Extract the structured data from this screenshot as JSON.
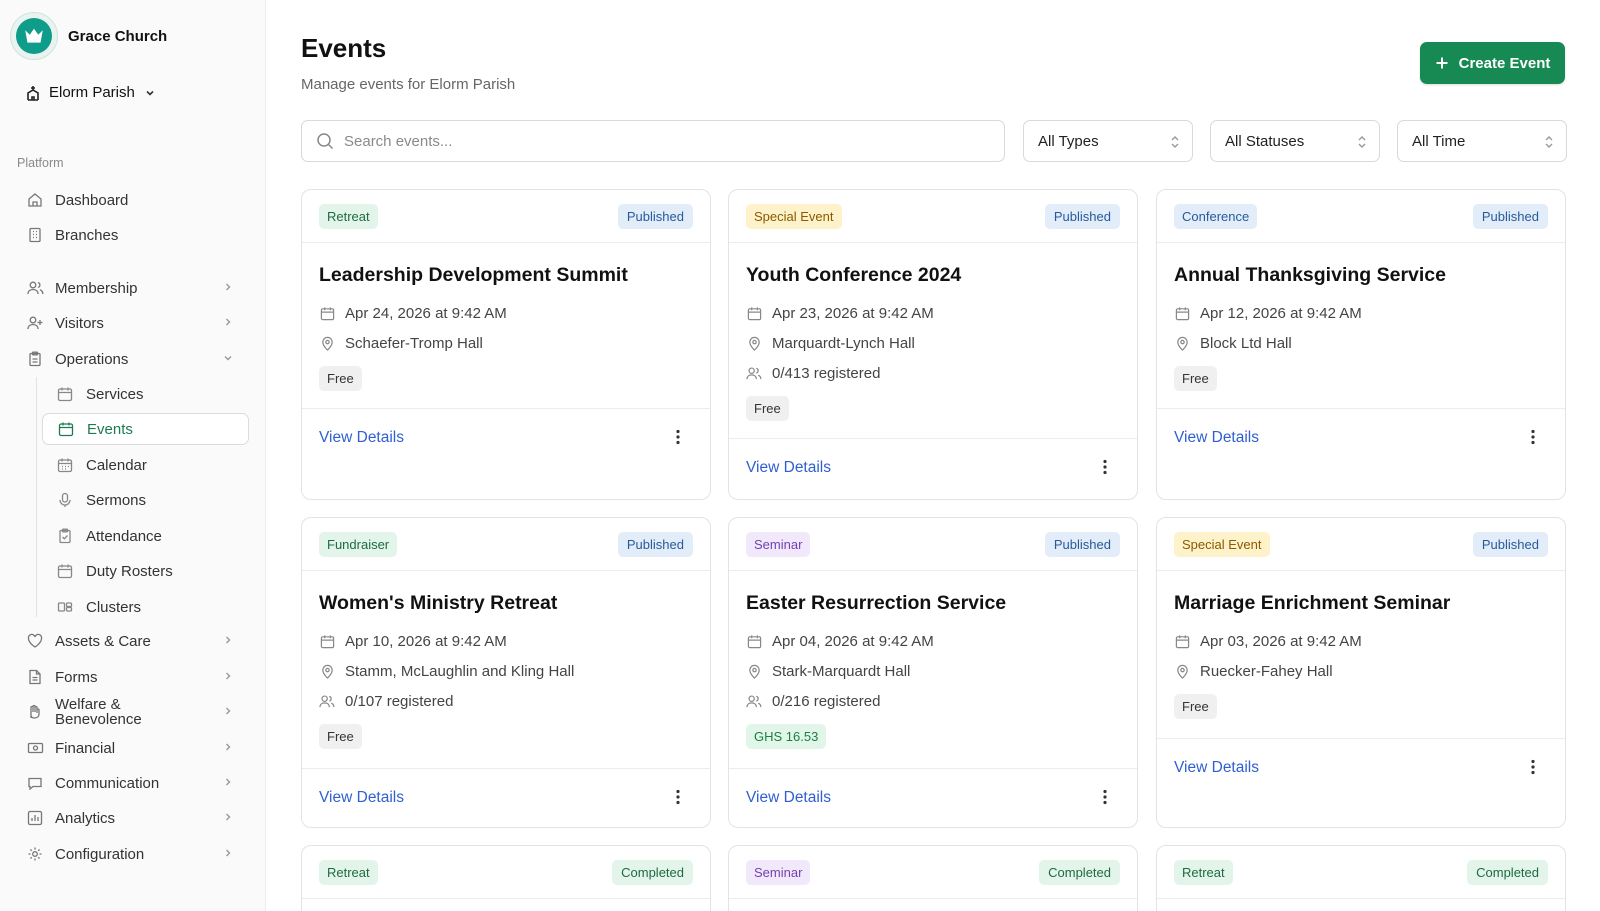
{
  "brand": {
    "name": "Grace Church"
  },
  "parish": {
    "name": "Elorm Parish"
  },
  "sidebar": {
    "section_label": "Platform",
    "items": [
      {
        "label": "Dashboard",
        "icon": "home-icon",
        "expandable": false
      },
      {
        "label": "Branches",
        "icon": "building-icon",
        "expandable": false
      },
      {
        "label": "Membership",
        "icon": "users-icon",
        "expandable": true
      },
      {
        "label": "Visitors",
        "icon": "user-plus-icon",
        "expandable": true
      },
      {
        "label": "Operations",
        "icon": "clipboard-icon",
        "expandable": true,
        "expanded": true
      },
      {
        "label": "Assets & Care",
        "icon": "heart-icon",
        "expandable": true
      },
      {
        "label": "Forms",
        "icon": "file-icon",
        "expandable": true
      },
      {
        "label": "Welfare & Benevolence",
        "icon": "hand-icon",
        "expandable": true
      },
      {
        "label": "Financial",
        "icon": "banknote-icon",
        "expandable": true
      },
      {
        "label": "Communication",
        "icon": "message-icon",
        "expandable": true
      },
      {
        "label": "Analytics",
        "icon": "bar-chart-icon",
        "expandable": true
      },
      {
        "label": "Configuration",
        "icon": "gear-icon",
        "expandable": true
      }
    ],
    "operations_sub": [
      {
        "label": "Services",
        "icon": "calendar-icon",
        "active": false
      },
      {
        "label": "Events",
        "icon": "calendar-icon",
        "active": true
      },
      {
        "label": "Calendar",
        "icon": "calendar-grid-icon",
        "active": false
      },
      {
        "label": "Sermons",
        "icon": "microphone-icon",
        "active": false
      },
      {
        "label": "Attendance",
        "icon": "clipboard-check-icon",
        "active": false
      },
      {
        "label": "Duty Rosters",
        "icon": "calendar-icon",
        "active": false
      },
      {
        "label": "Clusters",
        "icon": "group-icon",
        "active": false
      }
    ]
  },
  "header": {
    "title": "Events",
    "subtitle": "Manage events for Elorm Parish",
    "create_label": "Create Event"
  },
  "filters": {
    "search_placeholder": "Search events...",
    "type": "All Types",
    "status": "All Statuses",
    "time": "All Time"
  },
  "events": [
    {
      "type": "Retreat",
      "status": "Published",
      "title": "Leadership Development Summit",
      "date": "Apr 24, 2026 at 9:42 AM",
      "location": "Schaefer-Tromp Hall",
      "registered": null,
      "price": "Free",
      "link": "View Details"
    },
    {
      "type": "Special Event",
      "status": "Published",
      "title": "Youth Conference 2024",
      "date": "Apr 23, 2026 at 9:42 AM",
      "location": "Marquardt-Lynch Hall",
      "registered": "0/413 registered",
      "price": "Free",
      "link": "View Details"
    },
    {
      "type": "Conference",
      "status": "Published",
      "title": "Annual Thanksgiving Service",
      "date": "Apr 12, 2026 at 9:42 AM",
      "location": "Block Ltd Hall",
      "registered": null,
      "price": "Free",
      "link": "View Details"
    },
    {
      "type": "Fundraiser",
      "status": "Published",
      "title": "Women's Ministry Retreat",
      "date": "Apr 10, 2026 at 9:42 AM",
      "location": "Stamm, McLaughlin and Kling Hall",
      "registered": "0/107 registered",
      "price": "Free",
      "link": "View Details"
    },
    {
      "type": "Seminar",
      "status": "Published",
      "title": "Easter Resurrection Service",
      "date": "Apr 04, 2026 at 9:42 AM",
      "location": "Stark-Marquardt Hall",
      "registered": "0/216 registered",
      "price": "GHS 16.53",
      "link": "View Details"
    },
    {
      "type": "Special Event",
      "status": "Published",
      "title": "Marriage Enrichment Seminar",
      "date": "Apr 03, 2026 at 9:42 AM",
      "location": "Ruecker-Fahey Hall",
      "registered": null,
      "price": "Free",
      "link": "View Details"
    },
    {
      "type": "Retreat",
      "status": "Completed"
    },
    {
      "type": "Seminar",
      "status": "Completed"
    },
    {
      "type": "Retreat",
      "status": "Completed"
    }
  ],
  "colors": {
    "primary": "#178a53",
    "link": "#2f5fd0",
    "active_nav": "#1f7a4d"
  }
}
